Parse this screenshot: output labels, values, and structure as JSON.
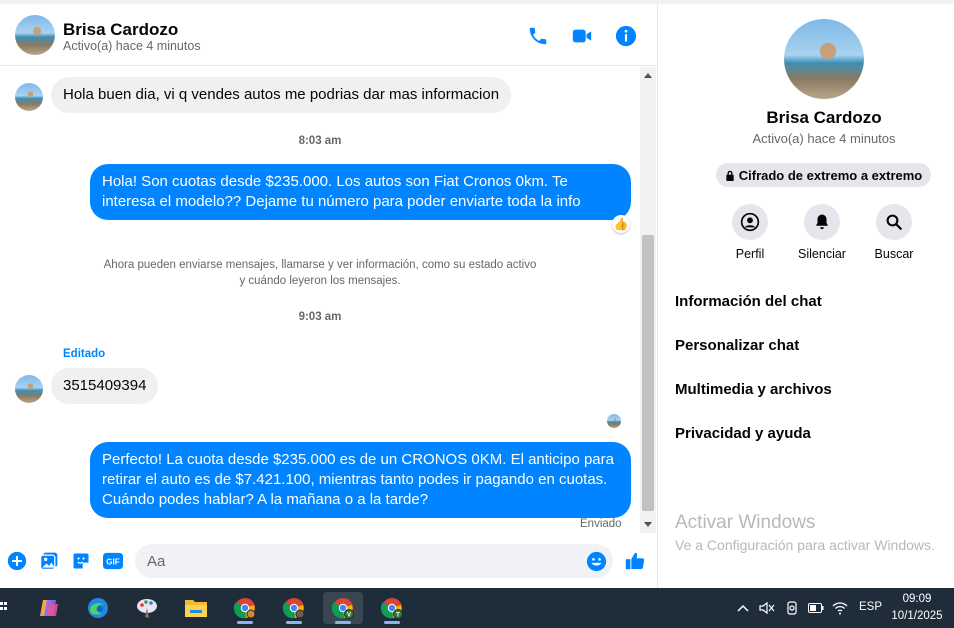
{
  "contact": {
    "name": "Brisa Cardozo",
    "status": "Activo(a) hace 4 minutos"
  },
  "colors": {
    "accent": "#0084ff",
    "incoming_bubble": "#f0f0f0",
    "taskbar": "#1f2d3a"
  },
  "header": {
    "icons": [
      "phone-icon",
      "video-camera-icon",
      "info-icon"
    ]
  },
  "messages": {
    "m1": "Hola buen dia, vi q vendes autos me podrias dar mas informacion",
    "time1": "8:03 am",
    "m2": "Hola! Son cuotas desde $235.000. Los autos son Fiat Cronos 0km. Te interesa el modelo?? Dejame tu número para poder enviarte toda la info",
    "reaction": "👍",
    "system_note": "Ahora pueden enviarse mensajes, llamarse y ver información, como su estado activo y cuándo leyeron los mensajes.",
    "time2": "9:03 am",
    "edited_label": "Editado",
    "m3": "3515409394",
    "m4": "Perfecto! La cuota desde $235.000 es de un CRONOS 0KM. El anticipo para retirar el auto es de $7.421.100, mientras tanto podes ir pagando en cuotas. Cuándo podes hablar? A la mañana o a la tarde?",
    "sent_label": "Enviado"
  },
  "composer": {
    "placeholder": "Aa",
    "icons": [
      "plus-circle-icon",
      "image-icon",
      "sticker-icon",
      "gif-icon",
      "emoji-icon",
      "thumbs-up-icon"
    ],
    "gif_label": "GIF"
  },
  "info_panel": {
    "name": "Brisa Cardozo",
    "status": "Activo(a) hace 4 minutos",
    "encryption_label": "Cifrado de extremo a extremo",
    "actions": [
      {
        "label": "Perfil",
        "icon": "profile-icon"
      },
      {
        "label": "Silenciar",
        "icon": "bell-icon"
      },
      {
        "label": "Buscar",
        "icon": "search-icon"
      }
    ],
    "menu": [
      "Información del chat",
      "Personalizar chat",
      "Multimedia y archivos",
      "Privacidad y ayuda"
    ]
  },
  "watermark": {
    "title": "Activar Windows",
    "subtitle": "Ve a Configuración para activar Windows."
  },
  "taskbar": {
    "apps": [
      "copilot-icon",
      "edge-icon",
      "paint-icon",
      "file-explorer-icon",
      "chrome-icon",
      "chrome-profile-icon",
      "chrome-profile-v-icon",
      "chrome-profile-t-icon"
    ],
    "profile_letters": [
      "",
      "",
      "V",
      "T"
    ],
    "language": "ESP",
    "time": "09:09",
    "date": "10/1/2025"
  }
}
